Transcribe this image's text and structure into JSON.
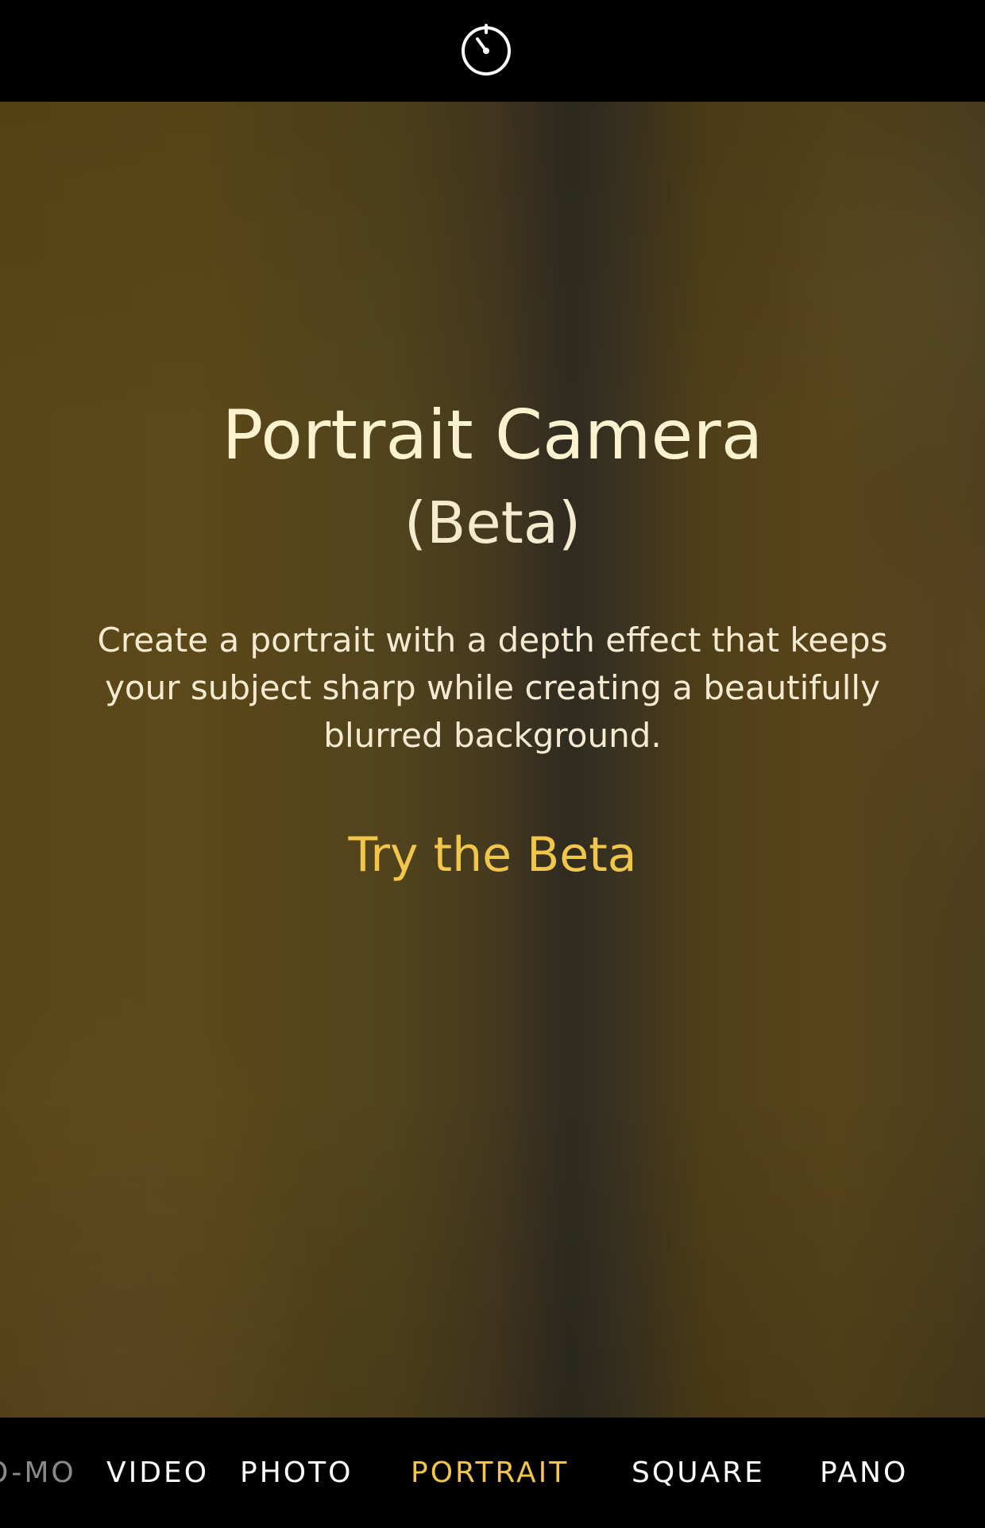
{
  "top_bar": {
    "timer_icon": "timer-icon"
  },
  "viewfinder": {
    "title": "Portrait Camera",
    "subtitle": "(Beta)",
    "description": "Create a portrait with a depth effect that keeps your subject sharp while creating a beautifully blurred background.",
    "try_beta_label": "Try the Beta"
  },
  "modes": {
    "items": [
      {
        "label": "O-MO"
      },
      {
        "label": "VIDEO"
      },
      {
        "label": "PHOTO"
      },
      {
        "label": "PORTRAIT",
        "selected": true
      },
      {
        "label": "SQUARE"
      },
      {
        "label": "PANO"
      }
    ]
  },
  "colors": {
    "accent": "#f1c64a",
    "text": "#fbf2cf",
    "bar_background": "#000000"
  }
}
